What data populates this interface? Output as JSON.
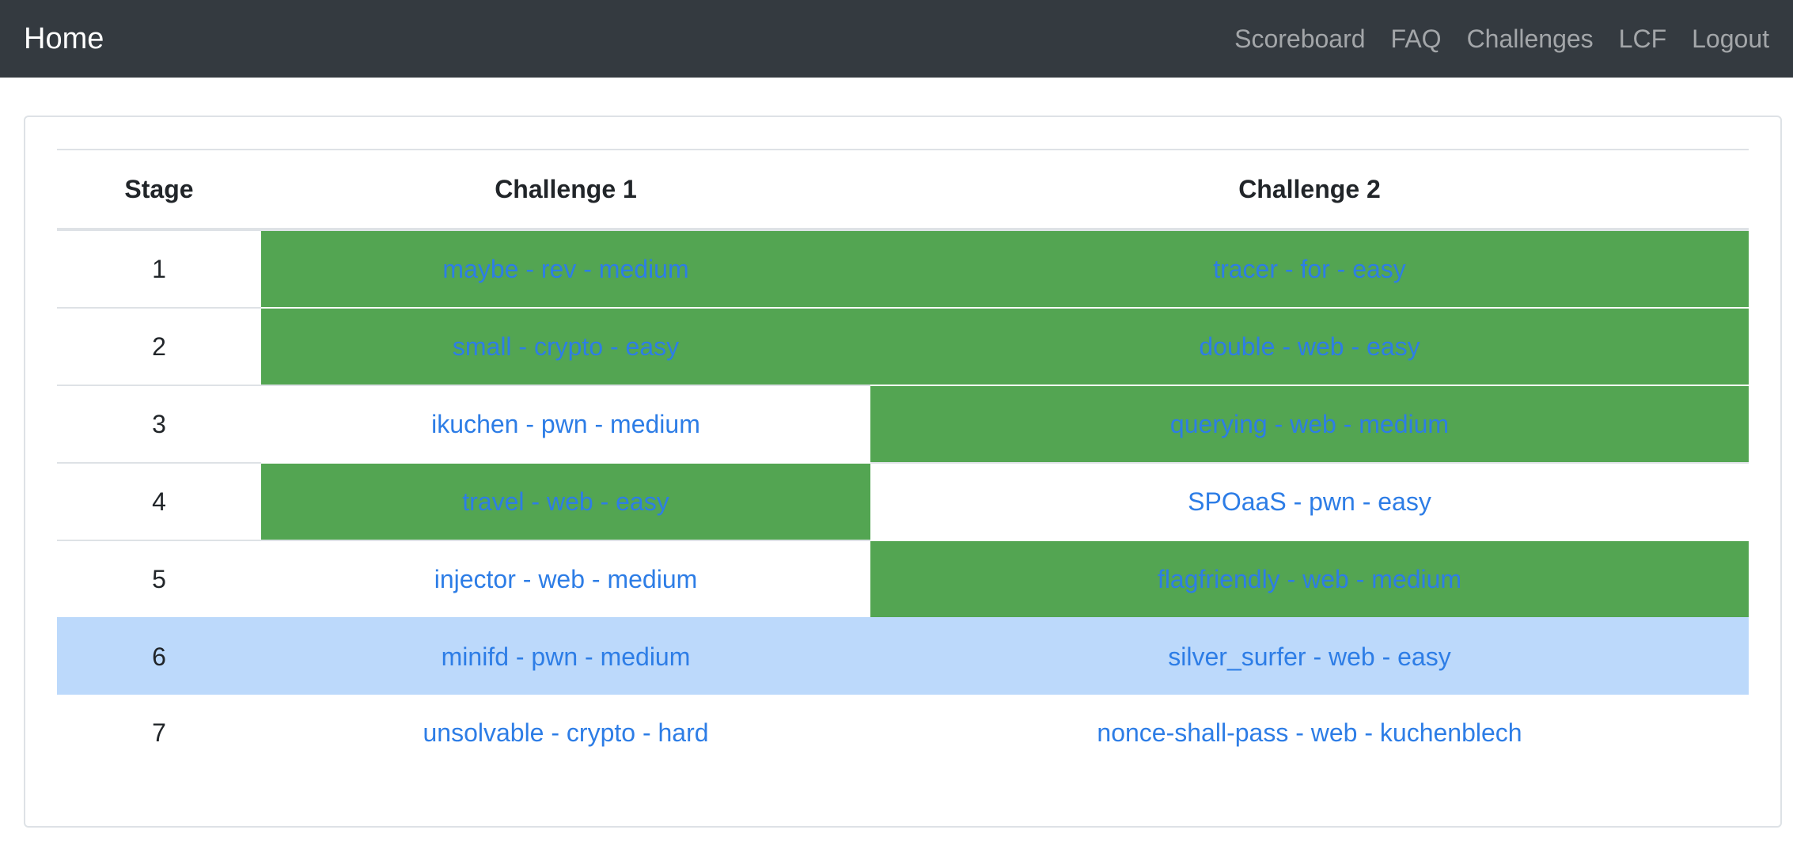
{
  "navbar": {
    "brand": "Home",
    "links": [
      "Scoreboard",
      "FAQ",
      "Challenges",
      "LCF",
      "Logout"
    ]
  },
  "table": {
    "headers": [
      "Stage",
      "Challenge 1",
      "Challenge 2"
    ],
    "rows": [
      {
        "stage": "1",
        "c1": "maybe - rev - medium",
        "c2": "tracer - for - easy"
      },
      {
        "stage": "2",
        "c1": "small - crypto - easy",
        "c2": "double - web - easy"
      },
      {
        "stage": "3",
        "c1": "ikuchen - pwn - medium",
        "c2": "querying - web - medium"
      },
      {
        "stage": "4",
        "c1": "travel - web - easy",
        "c2": "SPOaaS - pwn - easy"
      },
      {
        "stage": "5",
        "c1": "injector - web - medium",
        "c2": "flagfriendly - web - medium"
      },
      {
        "stage": "6",
        "c1": "minifd - pwn - medium",
        "c2": "silver_surfer - web - easy"
      },
      {
        "stage": "7",
        "c1": "unsolvable - crypto - hard",
        "c2": "nonce-shall-pass - web - kuchenblech"
      }
    ]
  },
  "colors": {
    "navbar_bg": "#343a40",
    "solved_bg": "#53a552",
    "active_row_bg": "#bcd9fb",
    "link": "#2d7de6"
  }
}
